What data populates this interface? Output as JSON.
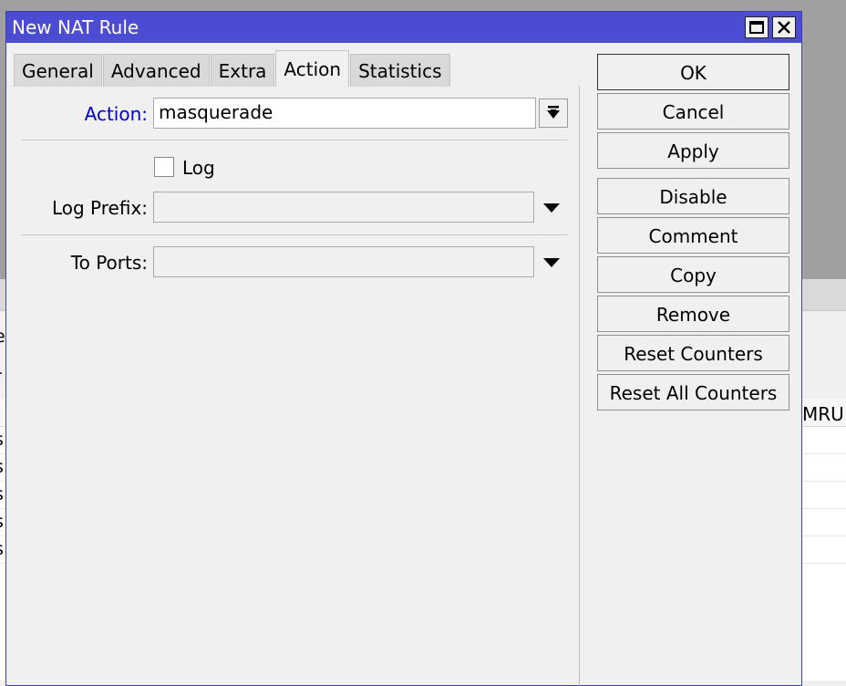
{
  "background": {
    "row_fragments": [
      "e",
      "r",
      "s",
      "s",
      "s",
      "s",
      "s"
    ],
    "column_header": "MRU"
  },
  "dialog": {
    "title": "New NAT Rule"
  },
  "tabs": [
    {
      "label": "General"
    },
    {
      "label": "Advanced"
    },
    {
      "label": "Extra"
    },
    {
      "label": "Action"
    },
    {
      "label": "Statistics"
    }
  ],
  "active_tab": "Action",
  "form": {
    "action_label": "Action:",
    "action_value": "masquerade",
    "log_label": "Log",
    "log_checked": false,
    "log_prefix_label": "Log Prefix:",
    "log_prefix_value": "",
    "to_ports_label": "To Ports:",
    "to_ports_value": ""
  },
  "buttons": {
    "ok": "OK",
    "cancel": "Cancel",
    "apply": "Apply",
    "disable": "Disable",
    "comment": "Comment",
    "copy": "Copy",
    "remove": "Remove",
    "reset_counters": "Reset Counters",
    "reset_all_counters": "Reset All Counters"
  },
  "colors": {
    "titlebar": "#4b4bd3",
    "action_label": "#0000d0"
  }
}
